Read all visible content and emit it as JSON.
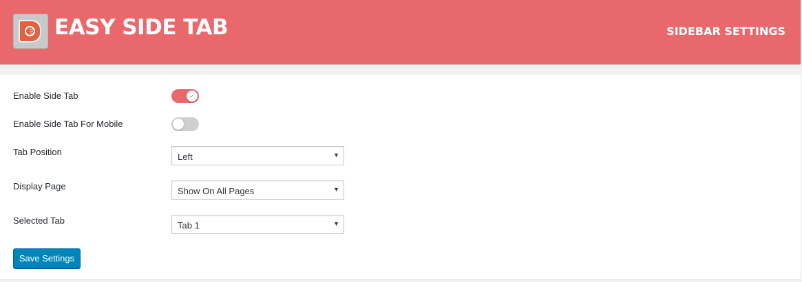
{
  "header": {
    "app_title": "EASY SIDE TAB",
    "section_title": "SIDEBAR SETTINGS",
    "background_color": "#e8686c",
    "logo_icon": "easy-side-tab-logo"
  },
  "settings": {
    "enable_side_tab": {
      "label": "Enable Side Tab",
      "enabled": true,
      "check_glyph": "✓"
    },
    "enable_mobile": {
      "label": "Enable Side Tab For Mobile",
      "enabled": false
    },
    "tab_position": {
      "label": "Tab Position",
      "value": "Left"
    },
    "display_page": {
      "label": "Display Page",
      "value": "Show On All Pages"
    },
    "selected_tab": {
      "label": "Selected Tab",
      "value": "Tab 1"
    },
    "dropdown_arrow": "▼"
  },
  "actions": {
    "save_label": "Save Settings",
    "save_color": "#0085ba"
  }
}
